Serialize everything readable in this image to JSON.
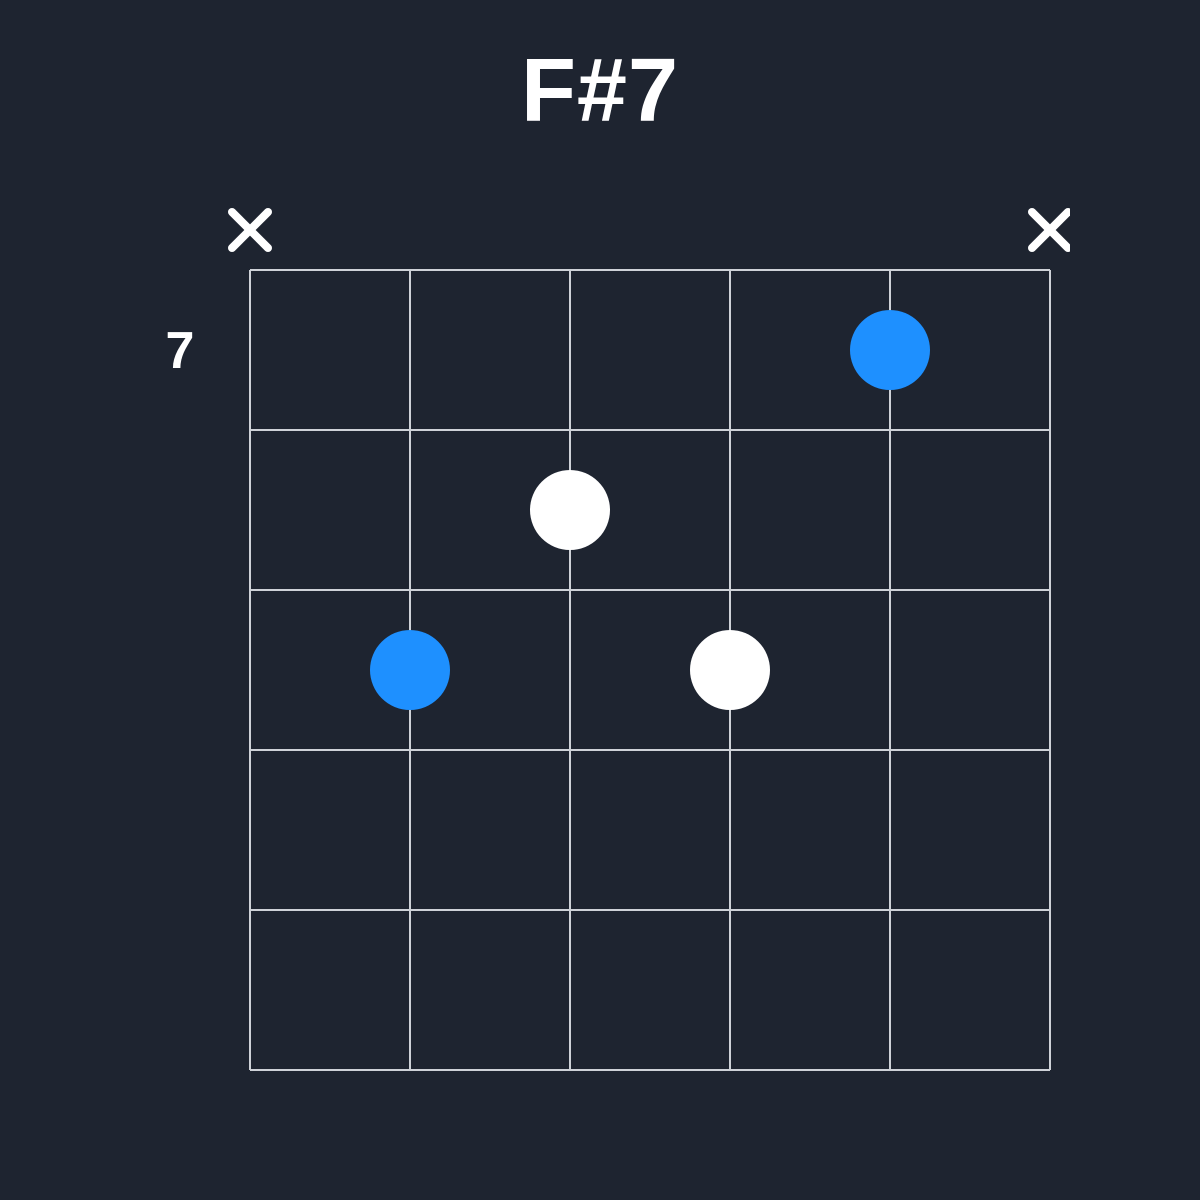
{
  "chord": {
    "name": "F#7",
    "start_fret_label": "7",
    "start_fret_value": 7,
    "strings": 6,
    "frets": 5,
    "string_status": [
      "mute",
      "none",
      "none",
      "none",
      "none",
      "mute"
    ],
    "dots": [
      {
        "string": 5,
        "fret": 1,
        "color": "accent"
      },
      {
        "string": 3,
        "fret": 2,
        "color": "white"
      },
      {
        "string": 2,
        "fret": 3,
        "color": "accent"
      },
      {
        "string": 4,
        "fret": 3,
        "color": "white"
      }
    ],
    "colors": {
      "bg": "#1e2430",
      "line": "#cfd2d8",
      "accent": "#1e90ff",
      "white": "#ffffff"
    }
  }
}
